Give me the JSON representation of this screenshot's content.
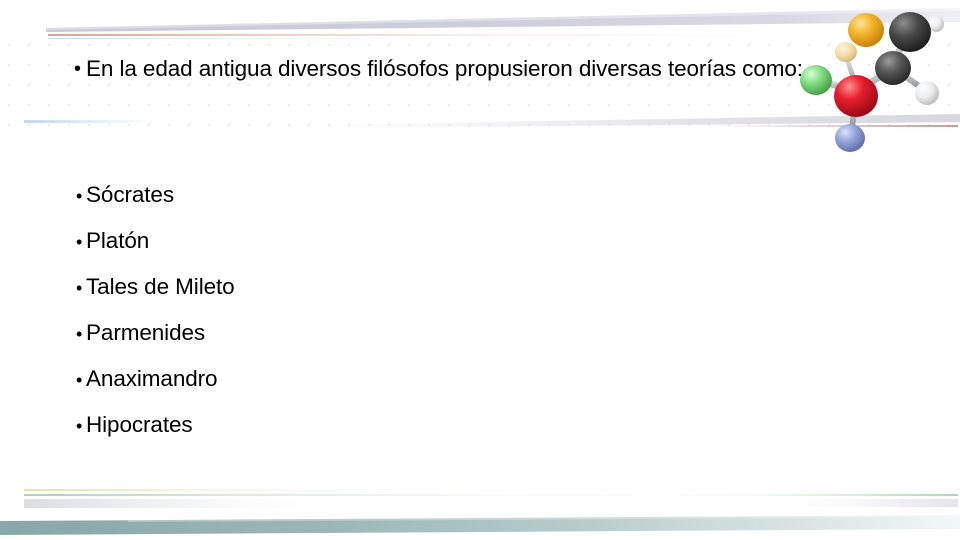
{
  "slide": {
    "background_color": "#ffffff",
    "text_color": "#000000",
    "intro": {
      "bullet_glyph": "•",
      "text": "En la edad antigua diversos filósofos propusieron diversas teorías como:"
    },
    "list": {
      "bullet_glyph": "•",
      "items": [
        {
          "label": "Sócrates"
        },
        {
          "label": "Platón"
        },
        {
          "label": "Tales de Mileto"
        },
        {
          "label": "Parmenides"
        },
        {
          "label": "Anaximandro"
        },
        {
          "label": "Hipocrates"
        }
      ]
    },
    "decorations": {
      "top_band_color": "#c3c4d4",
      "top_line_orange_color": "#d68870",
      "top_line_blue_color": "#b2c6e0",
      "mid_line_red_color": "#be807e",
      "bottom_line_yellow_color": "#e2dc96",
      "bottom_line_green_color": "#a2c4aa",
      "bottom_grey_band_color": "#d8dade",
      "bottom_wedge_color": "#8aa8a8"
    },
    "molecule": {
      "name": "molecule-graphic",
      "atoms": [
        {
          "name": "sulfur-atom",
          "color": "#f0a81e"
        },
        {
          "name": "carbon-atom-top",
          "color": "#3a3a3a"
        },
        {
          "name": "carbon-atom-center",
          "color": "#4a4a4a"
        },
        {
          "name": "oxygen-atom",
          "color": "#e01828"
        },
        {
          "name": "nitrogen-atom",
          "color": "#8c9ed8"
        },
        {
          "name": "chlorine-atom",
          "color": "#8ce08c"
        },
        {
          "name": "hydrogen-atom",
          "color": "#f2f2f2"
        },
        {
          "name": "pale-atom",
          "color": "#f0d8a8"
        }
      ],
      "bond_color": "#b9bcbe"
    }
  }
}
